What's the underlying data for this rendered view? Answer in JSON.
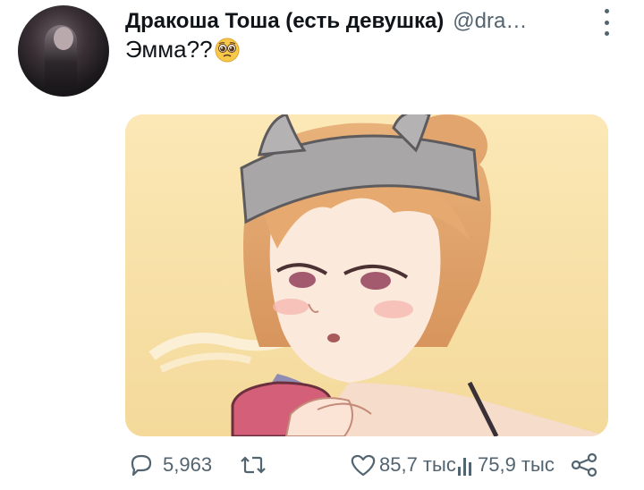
{
  "tweet": {
    "author_name": "Дракоша Тоша (есть девушка)",
    "author_handle": "@dra…",
    "text": "Эмма??",
    "emoji": "pleading-face"
  },
  "actions": {
    "replies": "5,963",
    "likes": "85,7 тыс",
    "views": "75,9 тыс"
  },
  "icons": [
    "more-icon",
    "reply-icon",
    "retweet-icon",
    "like-icon",
    "views-icon",
    "share-icon"
  ],
  "colors": {
    "text": "#0f1419",
    "secondary": "#536471",
    "image_background": "#f8e2a9"
  }
}
